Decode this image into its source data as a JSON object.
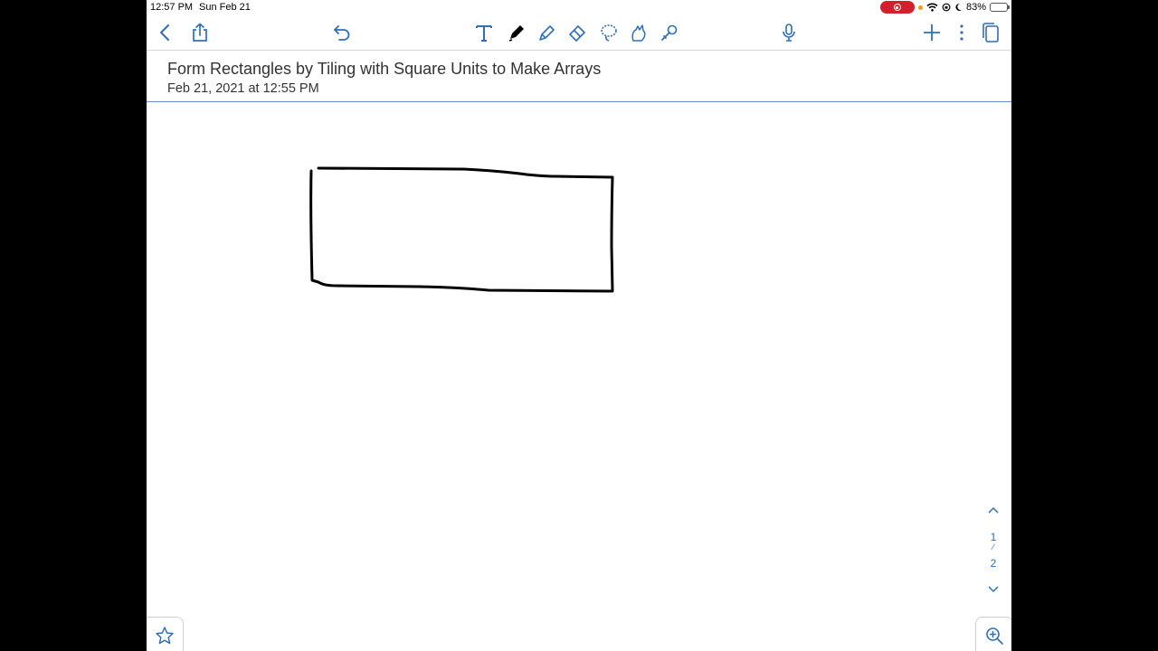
{
  "status_bar": {
    "time": "12:57 PM",
    "date": "Sun Feb 21",
    "battery": "83%",
    "battery_level": 0.83
  },
  "toolbar": {
    "left": [
      "back-icon",
      "share-icon"
    ],
    "center": [
      "undo-icon",
      "text-tool-icon",
      "pen-icon",
      "highlighter-icon",
      "eraser-icon",
      "lasso-icon",
      "shape-tool-icon",
      "laser-pointer-icon"
    ],
    "right": [
      "microphone-icon",
      "add-icon",
      "more-icon",
      "pages-icon"
    ],
    "accent_color": "#2f6fb8"
  },
  "note": {
    "title": "Form Rectangles by Tiling with Square Units to Make Arrays",
    "date": "Feb 21, 2021 at 12:55 PM"
  },
  "pager": {
    "current": "1",
    "separator": "⁄",
    "total": "2"
  },
  "bottom": {
    "left_icon": "star-icon",
    "right_icon": "zoom-in-icon"
  }
}
